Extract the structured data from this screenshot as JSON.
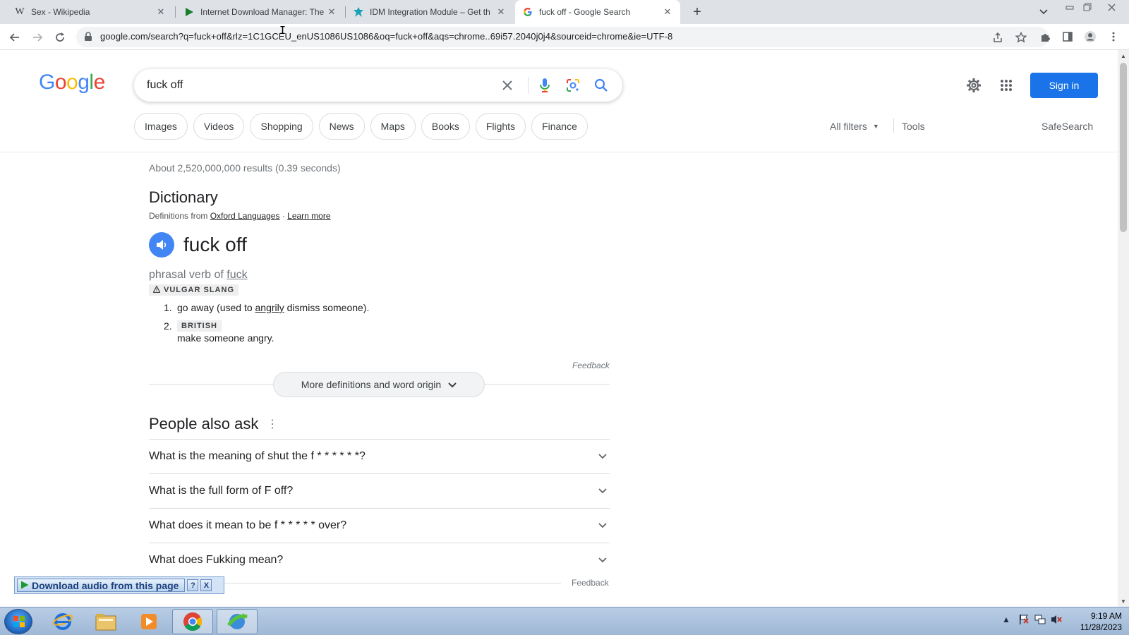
{
  "browser": {
    "tabs": [
      {
        "title": "Sex - Wikipedia",
        "favicon": "wikipedia-icon",
        "active": false
      },
      {
        "title": "Internet Download Manager: The",
        "favicon": "idm-play-icon",
        "active": false
      },
      {
        "title": "IDM Integration Module – Get th",
        "favicon": "idm-extension-icon",
        "active": false
      },
      {
        "title": "fuck off - Google Search",
        "favicon": "google-icon",
        "active": true
      }
    ],
    "url": "google.com/search?q=fuck+off&rlz=1C1GCEU_enUS1086US1086&oq=fuck+off&aqs=chrome..69i57.2040j0j4&sourceid=chrome&ie=UTF-8"
  },
  "google": {
    "logo": "Google",
    "logo_colors": [
      "#4285F4",
      "#EA4335",
      "#FBBC05",
      "#4285F4",
      "#34A853",
      "#EA4335"
    ],
    "search_query": "fuck off",
    "sign_in": "Sign in",
    "chips": [
      "Images",
      "Videos",
      "Shopping",
      "News",
      "Maps",
      "Books",
      "Flights",
      "Finance"
    ],
    "all_filters": "All filters",
    "tools": "Tools",
    "safesearch": "SafeSearch",
    "result_stats": "About 2,520,000,000 results (0.39 seconds)"
  },
  "dictionary": {
    "title": "Dictionary",
    "from_prefix": "Definitions from",
    "source": "Oxford Languages",
    "separator": "·",
    "learn_more": "Learn more",
    "headword": "fuck off",
    "pos_prefix": "phrasal verb of",
    "pos_link": "fuck",
    "register_label": "VULGAR SLANG",
    "definitions": [
      {
        "num": "1.",
        "before": "go away (used to",
        "link": "angrily",
        "after": "dismiss someone)."
      },
      {
        "num": "2.",
        "label": "BRITISH",
        "text": "make someone angry."
      }
    ],
    "feedback": "Feedback",
    "more_button": "More definitions and word origin"
  },
  "people_also_ask": {
    "title": "People also ask",
    "questions": [
      "What is the meaning of shut the f * * * * * *?",
      "What is the full form of F off?",
      "What does it mean to be f * * * * * over?",
      "What does Fukking mean?"
    ],
    "feedback": "Feedback"
  },
  "idm_panel": {
    "label": "Download audio from this page",
    "help": "?",
    "close": "X"
  },
  "taskbar": {
    "apps": [
      "internet-explorer-icon",
      "file-explorer-icon",
      "media-player-icon",
      "chrome-icon",
      "idm-icon"
    ],
    "time": "9:19 AM",
    "date": "11/28/2023"
  },
  "colors": {
    "accent_blue": "#1a73e8",
    "speaker_blue": "#4285f4",
    "tab_strip": "#dee1e6",
    "taskbar": "#b9cde5"
  }
}
